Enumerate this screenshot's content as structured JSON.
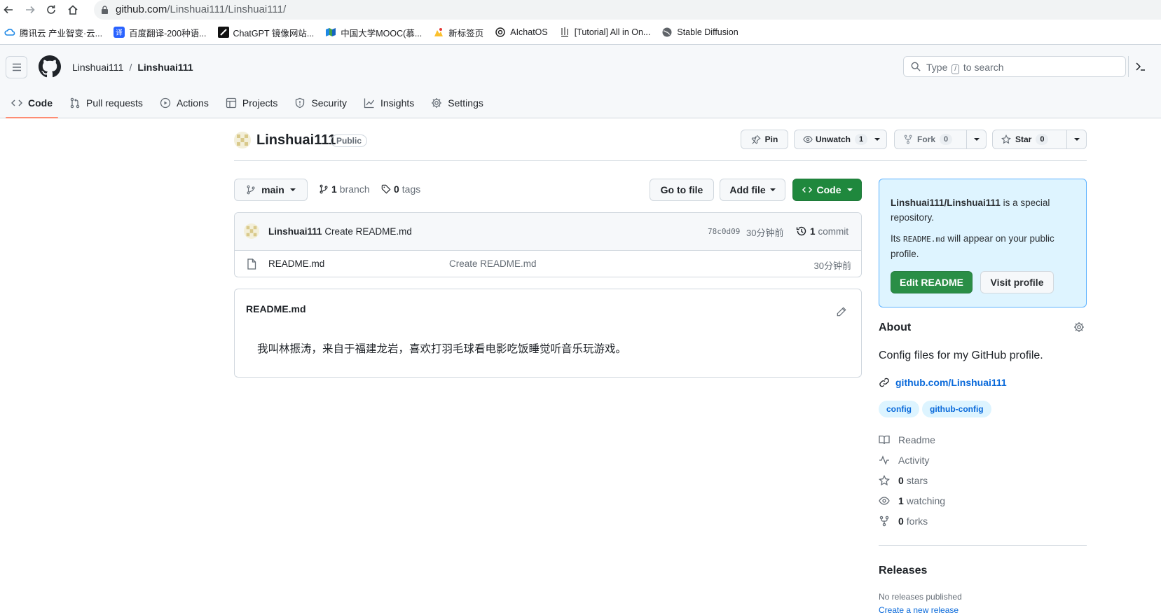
{
  "browser": {
    "url_host": "github.com",
    "url_path": "/Linshuai111/Linshuai111/",
    "bookmarks": [
      {
        "label": "腾讯云 产业智变·云...",
        "icon": "cloud-icon"
      },
      {
        "label": "百度翻译-200种语...",
        "icon": "translate-icon"
      },
      {
        "label": "ChatGPT 镜像网站...",
        "icon": "chatgpt-icon"
      },
      {
        "label": "中国大学MOOC(慕...",
        "icon": "mooc-icon"
      },
      {
        "label": "新标签页",
        "icon": "newtab-icon"
      },
      {
        "label": "AIchatOS",
        "icon": "openai-icon"
      },
      {
        "label": "[Tutorial] All in On...",
        "icon": "tutorial-icon"
      },
      {
        "label": "Stable Diffusion",
        "icon": "globe-icon"
      }
    ]
  },
  "header": {
    "owner": "Linshuai111",
    "separator": "/",
    "repo": "Linshuai111",
    "search_prefix": "Type",
    "search_key": "/",
    "search_suffix": "to search"
  },
  "tabs": [
    {
      "label": "Code",
      "icon": "code-icon",
      "active": true
    },
    {
      "label": "Pull requests",
      "icon": "pull-request-icon"
    },
    {
      "label": "Actions",
      "icon": "play-icon"
    },
    {
      "label": "Projects",
      "icon": "table-icon"
    },
    {
      "label": "Security",
      "icon": "shield-icon"
    },
    {
      "label": "Insights",
      "icon": "graph-icon"
    },
    {
      "label": "Settings",
      "icon": "gear-icon"
    }
  ],
  "repo": {
    "title": "Linshuai111",
    "visibility": "Public",
    "pin_label": "Pin",
    "unwatch_label": "Unwatch",
    "watch_count": "1",
    "fork_label": "Fork",
    "fork_count": "0",
    "star_label": "Star",
    "star_count": "0"
  },
  "branchbar": {
    "branch": "main",
    "branch_count": "1",
    "branch_word": "branch",
    "tag_count": "0",
    "tag_word": "tags",
    "goto_file": "Go to file",
    "add_file": "Add file",
    "code": "Code"
  },
  "commit": {
    "author": "Linshuai111",
    "message": "Create README.md",
    "sha": "78c0d09",
    "time": "30分钟前",
    "count": "1",
    "count_word": "commit"
  },
  "files": [
    {
      "name": "README.md",
      "message": "Create README.md",
      "time": "30分钟前"
    }
  ],
  "readme": {
    "filename": "README.md",
    "content": "我叫林振涛，来自于福建龙岩，喜欢打羽毛球看电影吃饭睡觉听音乐玩游戏。"
  },
  "special": {
    "repo_name": "Linshuai111/Linshuai111",
    "line1_rest": "is a special repository.",
    "line2_prefix": "Its",
    "line2_code": "README.md",
    "line2_rest": "will appear on your public profile.",
    "edit_button": "Edit README",
    "visit_button": "Visit profile"
  },
  "about": {
    "heading": "About",
    "description": "Config files for my GitHub profile.",
    "link": "github.com/Linshuai111",
    "topics": [
      "config",
      "github-config"
    ],
    "stats": [
      {
        "icon": "book-icon",
        "strong": "",
        "label": "Readme"
      },
      {
        "icon": "pulse-icon",
        "strong": "",
        "label": "Activity"
      },
      {
        "icon": "star-icon",
        "strong": "0",
        "label": "stars"
      },
      {
        "icon": "eye-icon",
        "strong": "1",
        "label": "watching"
      },
      {
        "icon": "fork-icon",
        "strong": "0",
        "label": "forks"
      }
    ]
  },
  "releases": {
    "heading": "Releases",
    "empty": "No releases published",
    "create": "Create a new release"
  },
  "colors": {
    "accent": "#0969da",
    "primary_button": "#1f883d",
    "tab_underline": "#fd8c73",
    "special_bg": "#ddf4ff"
  }
}
